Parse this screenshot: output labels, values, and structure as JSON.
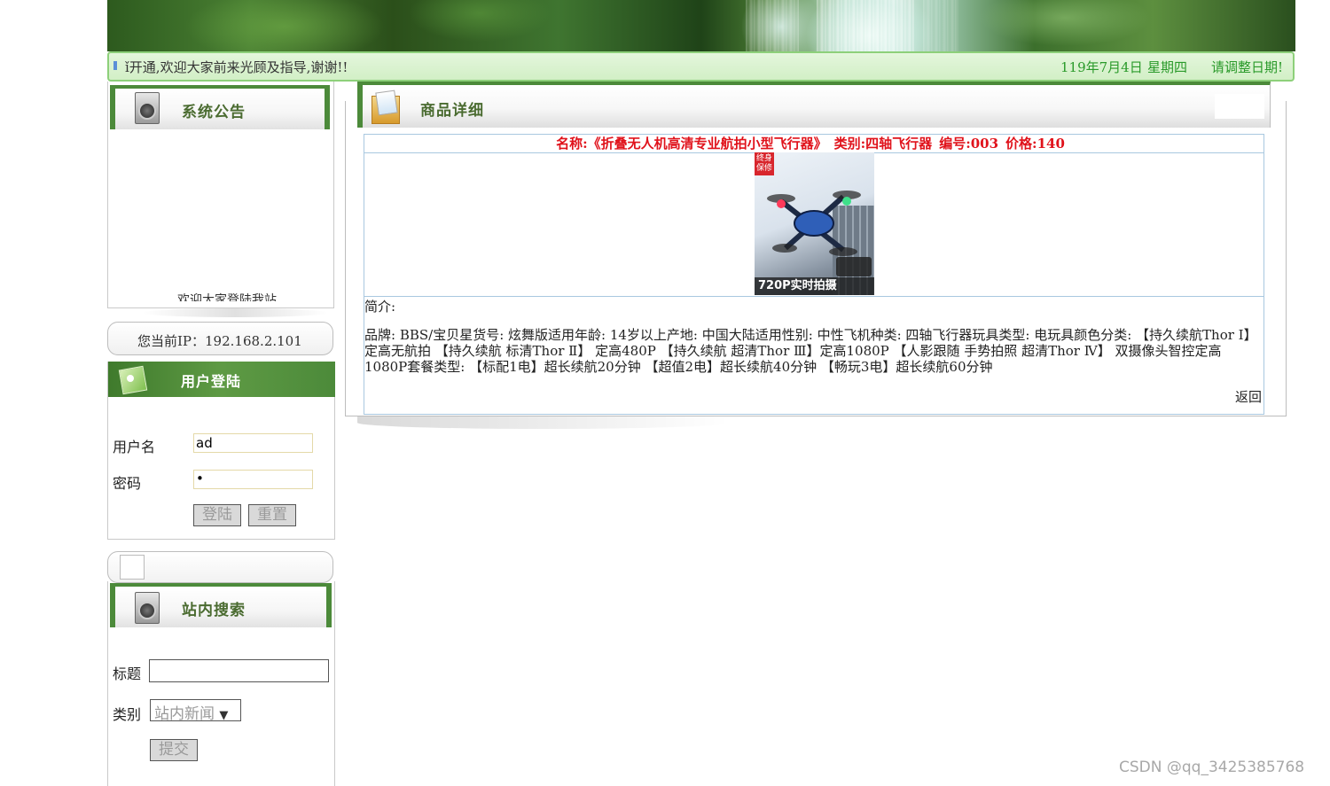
{
  "marquee": {
    "text": "ǐ开通,欢迎大家前来光顾及指导,谢谢!!",
    "date": "119年7月4日",
    "weekday": "星期四",
    "adjust_date": "请调整日期!"
  },
  "sidebar": {
    "notice": {
      "title": "系统公告",
      "welcome": "欢迎大家登陆我站."
    },
    "ip": {
      "label": "您当前IP：192.168.2.101"
    },
    "login": {
      "title": "用户登陆",
      "username_label": "用户名",
      "username_value": "ad",
      "password_label": "密码",
      "password_value": "•",
      "login_button": "登陆",
      "reset_button": "重置"
    },
    "search": {
      "title": "站内搜索",
      "title_field_label": "标题",
      "title_field_value": "",
      "category_label": "类别",
      "category_selected": "站内新闻",
      "submit_button": "提交"
    }
  },
  "main": {
    "title": "商品详细",
    "product": {
      "name": "名称:《折叠无人机高清专业航拍小型飞行器》",
      "category": "类别:四轴飞行器",
      "number": "编号:003",
      "price": "价格:140",
      "image_badge": "终身保修",
      "image_caption": "720P实时拍摄",
      "intro_label": "简介:",
      "description": "品牌: BBS/宝贝星货号: 炫舞版适用年龄: 14岁以上产地: 中国大陆适用性别: 中性飞机种类: 四轴飞行器玩具类型: 电玩具颜色分类: 【持久续航Thor Ⅰ】定高无航拍 【持久续航 标清Thor Ⅱ】 定高480P 【持久续航 超清Thor Ⅲ】定高1080P 【人影跟随 手势拍照 超清Thor Ⅳ】 双摄像头智控定高1080P套餐类型: 【标配1电】超长续航20分钟 【超值2电】超长续航40分钟 【畅玩3电】超长续航60分钟",
      "back_link": "返回"
    }
  },
  "watermark": "CSDN @qq_3425385768",
  "colors": {
    "accent_green": "#4c8a3a",
    "price_red": "#e0121b",
    "marquee_green": "#2a9a2a"
  },
  "icons": [
    "washer-icon",
    "folder-photo-icon",
    "leaf-card-icon",
    "bullet-icon"
  ]
}
